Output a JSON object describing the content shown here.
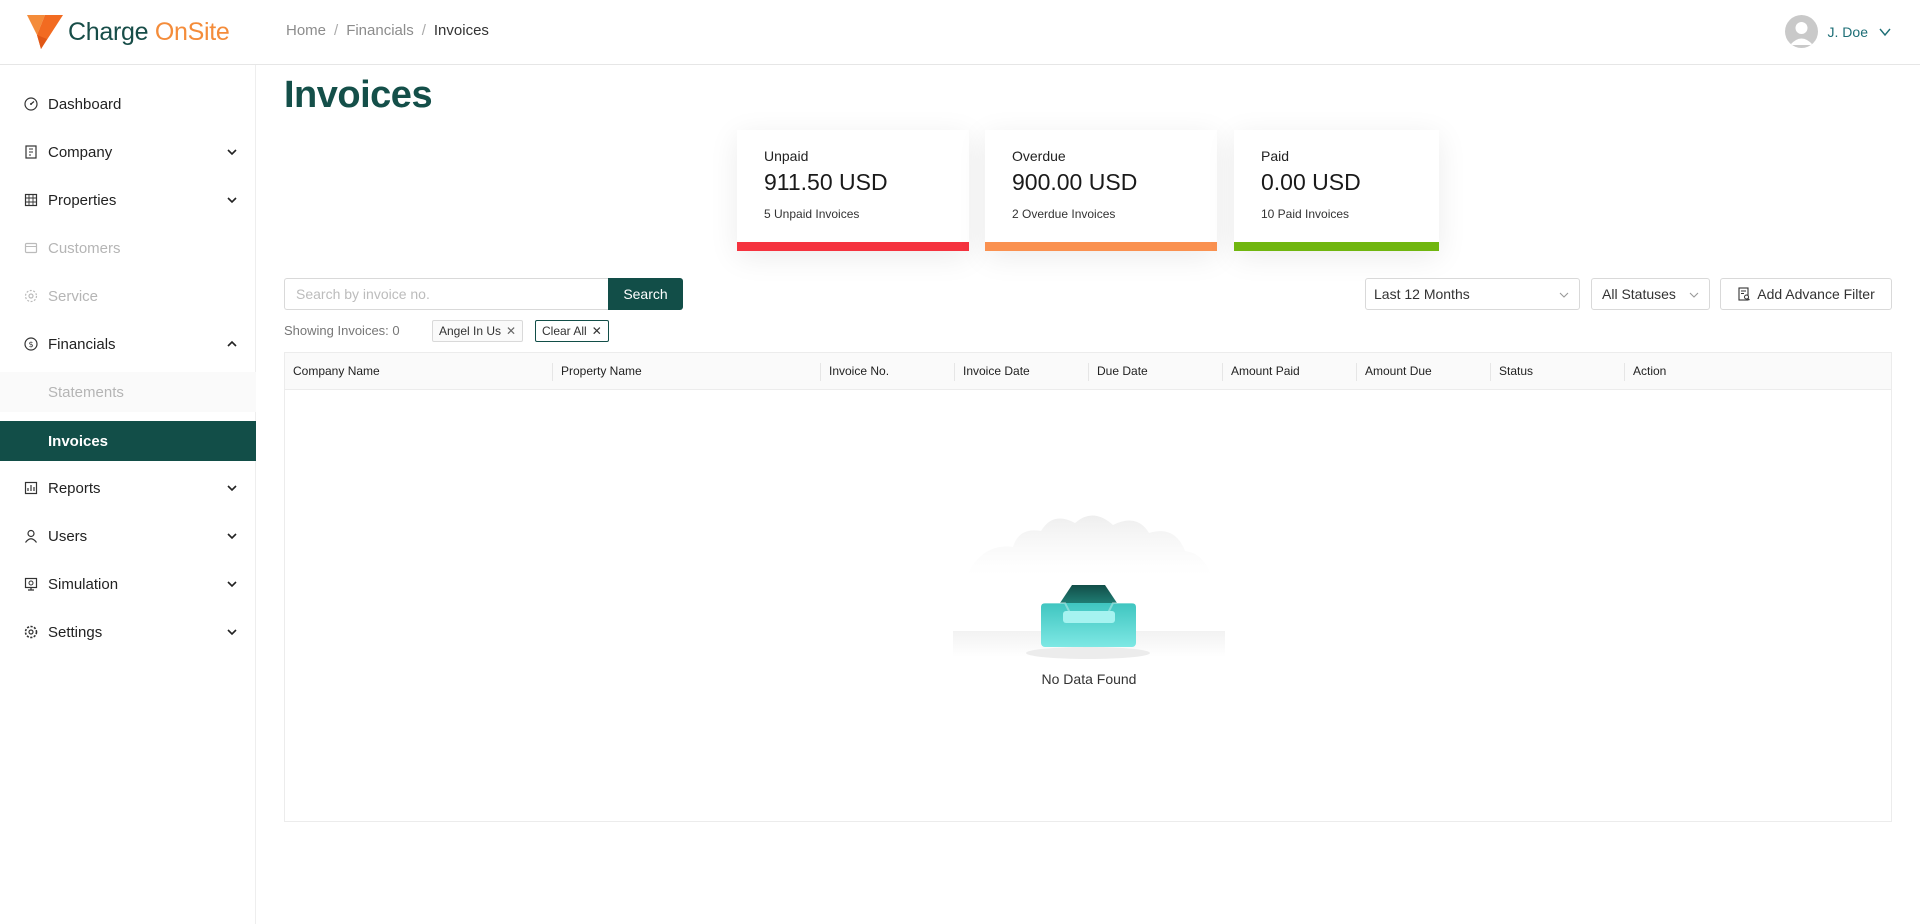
{
  "brand": {
    "name_part1": "Charge ",
    "name_part2": "OnSite",
    "primary_color": "#124e48",
    "accent_color": "#f48c3a"
  },
  "breadcrumb": {
    "items": [
      "Home",
      "Financials",
      "Invoices"
    ],
    "separator": "/"
  },
  "user": {
    "name": "J. Doe"
  },
  "sidebar": {
    "items": [
      {
        "label": "Dashboard",
        "icon": "dashboard-icon"
      },
      {
        "label": "Company",
        "icon": "building-icon"
      },
      {
        "label": "Properties",
        "icon": "grid-building-icon"
      },
      {
        "label": "Customers",
        "icon": "customers-icon"
      },
      {
        "label": "Service",
        "icon": "gear-icon"
      },
      {
        "label": "Financials",
        "icon": "dollar-circle-icon"
      },
      {
        "label": "Statements"
      },
      {
        "label": "Invoices"
      },
      {
        "label": "Reports",
        "icon": "report-icon"
      },
      {
        "label": "Users",
        "icon": "user-icon"
      },
      {
        "label": "Simulation",
        "icon": "simulation-icon"
      },
      {
        "label": "Settings",
        "icon": "settings-icon"
      }
    ]
  },
  "page": {
    "title": "Invoices"
  },
  "cards": [
    {
      "label": "Unpaid",
      "amount": "911.50 USD",
      "sub": "5 Unpaid Invoices",
      "color": "#f5333f"
    },
    {
      "label": "Overdue",
      "amount": "900.00 USD",
      "sub": "2 Overdue Invoices",
      "color": "#fa9150"
    },
    {
      "label": "Paid",
      "amount": "0.00 USD",
      "sub": "10 Paid Invoices",
      "color": "#70b60f"
    }
  ],
  "search": {
    "placeholder": "Search by invoice no.",
    "button_label": "Search"
  },
  "filters": {
    "period": "Last 12 Months",
    "status": "All Statuses",
    "advance_label": "Add Advance Filter"
  },
  "results": {
    "showing": "Showing Invoices: 0"
  },
  "tags": {
    "active": "Angel In Us",
    "clear": "Clear All"
  },
  "table": {
    "columns": [
      "Company Name",
      "Property Name",
      "Invoice No.",
      "Invoice Date",
      "Due Date",
      "Amount Paid",
      "Amount Due",
      "Status",
      "Action"
    ],
    "empty_text": "No Data Found"
  }
}
